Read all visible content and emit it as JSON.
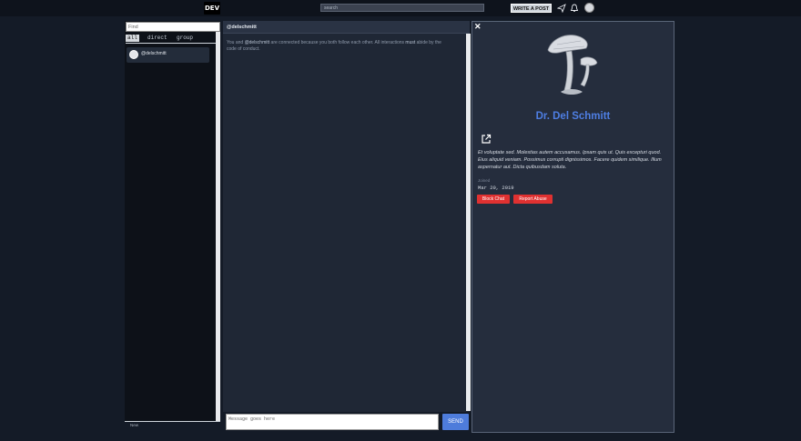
{
  "nav": {
    "logo": "DEV",
    "search_placeholder": "search",
    "write_label": "WRITE A POST"
  },
  "sidebar": {
    "filter_placeholder": "Find",
    "tabs": [
      "all",
      "direct",
      "group"
    ],
    "conversations": [
      {
        "name": "@delschmitt"
      }
    ],
    "footer": "New"
  },
  "chat": {
    "title": "@delschmitt",
    "message_prefix": "You and ",
    "message_user": "@delschmitt",
    "message_middle": " are connected because you both follow each other. All interactions ",
    "message_must": "must",
    "message_suffix": " abide by the code of conduct.",
    "input_placeholder": "Message goes here",
    "send_label": "SEND"
  },
  "profile": {
    "name": "Dr. Del Schmitt",
    "bio": "Et voluptate sed. Molestias autem accusamus. Ipsam quis ut. Quis excepturi quod. Eius aliquid veniam. Possimus corrupti dignissimos. Facere quidem similique. Illum aspernatur aut. Dicta quibusdam soluta.",
    "joined_label": "Joined",
    "joined_date": "Mar 20, 2019",
    "block_label": "Block Chat",
    "report_label": "Report Abuse"
  },
  "colors": {
    "accent": "#4e7cdb",
    "danger": "#e03131",
    "background": "#141b27"
  }
}
